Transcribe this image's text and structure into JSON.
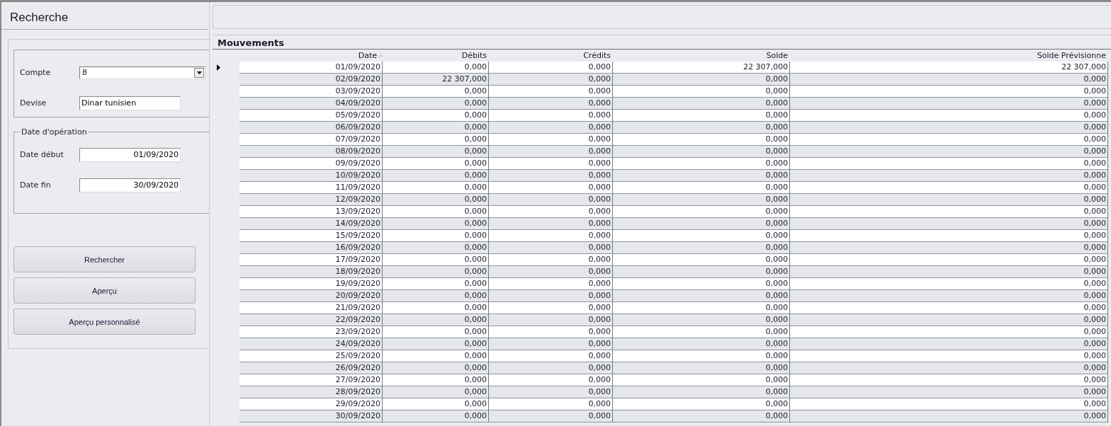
{
  "search_panel": {
    "title": "Recherche",
    "compte": {
      "label": "Compte",
      "value": "8"
    },
    "devise": {
      "label": "Devise",
      "value": "Dinar tunisien"
    },
    "date_group": {
      "legend": "Date d'opération",
      "start": {
        "label": "Date début",
        "value": "01/09/2020"
      },
      "end": {
        "label": "Date fin",
        "value": "30/09/2020"
      }
    },
    "buttons": [
      "Rechercher",
      "Aperçu",
      "Aperçu personnalisé"
    ]
  },
  "grid": {
    "title": "Mouvements",
    "columns": [
      {
        "label": "Date",
        "sorted": true
      },
      {
        "label": "Débits",
        "sorted": false
      },
      {
        "label": "Crédits",
        "sorted": false
      },
      {
        "label": "Solde",
        "sorted": false
      },
      {
        "label": "Solde Prévisionne",
        "sorted": false
      }
    ],
    "rows": [
      {
        "selected": true,
        "cells": [
          "01/09/2020",
          "0,000",
          "0,000",
          "22 307,000",
          "22 307,000"
        ]
      },
      {
        "selected": false,
        "cells": [
          "02/09/2020",
          "22 307,000",
          "0,000",
          "0,000",
          "0,000"
        ]
      },
      {
        "selected": false,
        "cells": [
          "03/09/2020",
          "0,000",
          "0,000",
          "0,000",
          "0,000"
        ]
      },
      {
        "selected": false,
        "cells": [
          "04/09/2020",
          "0,000",
          "0,000",
          "0,000",
          "0,000"
        ]
      },
      {
        "selected": false,
        "cells": [
          "05/09/2020",
          "0,000",
          "0,000",
          "0,000",
          "0,000"
        ]
      },
      {
        "selected": false,
        "cells": [
          "06/09/2020",
          "0,000",
          "0,000",
          "0,000",
          "0,000"
        ]
      },
      {
        "selected": false,
        "cells": [
          "07/09/2020",
          "0,000",
          "0,000",
          "0,000",
          "0,000"
        ]
      },
      {
        "selected": false,
        "cells": [
          "08/09/2020",
          "0,000",
          "0,000",
          "0,000",
          "0,000"
        ]
      },
      {
        "selected": false,
        "cells": [
          "09/09/2020",
          "0,000",
          "0,000",
          "0,000",
          "0,000"
        ]
      },
      {
        "selected": false,
        "cells": [
          "10/09/2020",
          "0,000",
          "0,000",
          "0,000",
          "0,000"
        ]
      },
      {
        "selected": false,
        "cells": [
          "11/09/2020",
          "0,000",
          "0,000",
          "0,000",
          "0,000"
        ]
      },
      {
        "selected": false,
        "cells": [
          "12/09/2020",
          "0,000",
          "0,000",
          "0,000",
          "0,000"
        ]
      },
      {
        "selected": false,
        "cells": [
          "13/09/2020",
          "0,000",
          "0,000",
          "0,000",
          "0,000"
        ]
      },
      {
        "selected": false,
        "cells": [
          "14/09/2020",
          "0,000",
          "0,000",
          "0,000",
          "0,000"
        ]
      },
      {
        "selected": false,
        "cells": [
          "15/09/2020",
          "0,000",
          "0,000",
          "0,000",
          "0,000"
        ]
      },
      {
        "selected": false,
        "cells": [
          "16/09/2020",
          "0,000",
          "0,000",
          "0,000",
          "0,000"
        ]
      },
      {
        "selected": false,
        "cells": [
          "17/09/2020",
          "0,000",
          "0,000",
          "0,000",
          "0,000"
        ]
      },
      {
        "selected": false,
        "cells": [
          "18/09/2020",
          "0,000",
          "0,000",
          "0,000",
          "0,000"
        ]
      },
      {
        "selected": false,
        "cells": [
          "19/09/2020",
          "0,000",
          "0,000",
          "0,000",
          "0,000"
        ]
      },
      {
        "selected": false,
        "cells": [
          "20/09/2020",
          "0,000",
          "0,000",
          "0,000",
          "0,000"
        ]
      },
      {
        "selected": false,
        "cells": [
          "21/09/2020",
          "0,000",
          "0,000",
          "0,000",
          "0,000"
        ]
      },
      {
        "selected": false,
        "cells": [
          "22/09/2020",
          "0,000",
          "0,000",
          "0,000",
          "0,000"
        ]
      },
      {
        "selected": false,
        "cells": [
          "23/09/2020",
          "0,000",
          "0,000",
          "0,000",
          "0,000"
        ]
      },
      {
        "selected": false,
        "cells": [
          "24/09/2020",
          "0,000",
          "0,000",
          "0,000",
          "0,000"
        ]
      },
      {
        "selected": false,
        "cells": [
          "25/09/2020",
          "0,000",
          "0,000",
          "0,000",
          "0,000"
        ]
      },
      {
        "selected": false,
        "cells": [
          "26/09/2020",
          "0,000",
          "0,000",
          "0,000",
          "0,000"
        ]
      },
      {
        "selected": false,
        "cells": [
          "27/09/2020",
          "0,000",
          "0,000",
          "0,000",
          "0,000"
        ]
      },
      {
        "selected": false,
        "cells": [
          "28/09/2020",
          "0,000",
          "0,000",
          "0,000",
          "0,000"
        ]
      },
      {
        "selected": false,
        "cells": [
          "29/09/2020",
          "0,000",
          "0,000",
          "0,000",
          "0,000"
        ]
      },
      {
        "selected": false,
        "cells": [
          "30/09/2020",
          "0,000",
          "0,000",
          "0,000",
          "0,000"
        ]
      }
    ]
  }
}
